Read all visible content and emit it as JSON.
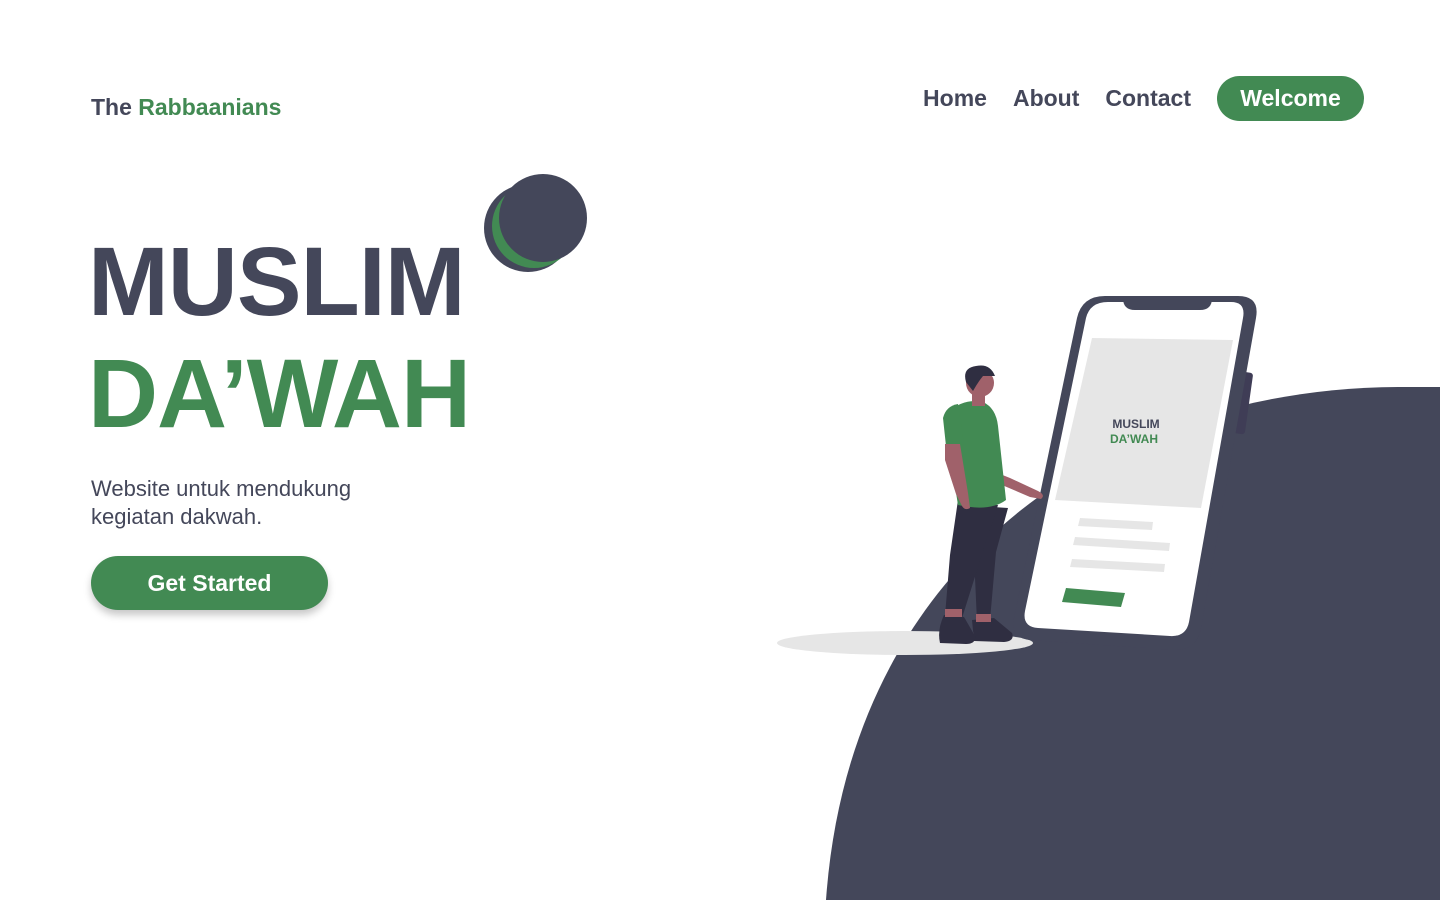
{
  "header": {
    "brand_prefix": "The",
    "brand_accent": "Rabbaanians",
    "nav": {
      "home": "Home",
      "about": "About",
      "contact": "Contact",
      "welcome": "Welcome"
    }
  },
  "hero": {
    "title_line1": "MUSLIM",
    "title_line2": "DA’WAH",
    "subtitle": "Website untuk mendukung kegiatan dakwah.",
    "cta_label": "Get Started"
  },
  "illustration": {
    "phone_screen_line1": "MUSLIM",
    "phone_screen_line2": "DA’WAH"
  },
  "colors": {
    "primary_green": "#428a53",
    "dark_slate": "#44475a",
    "background": "#ffffff",
    "light_gray": "#e6e6e6"
  },
  "icons": {
    "logo": "crescent-moon-icon"
  }
}
